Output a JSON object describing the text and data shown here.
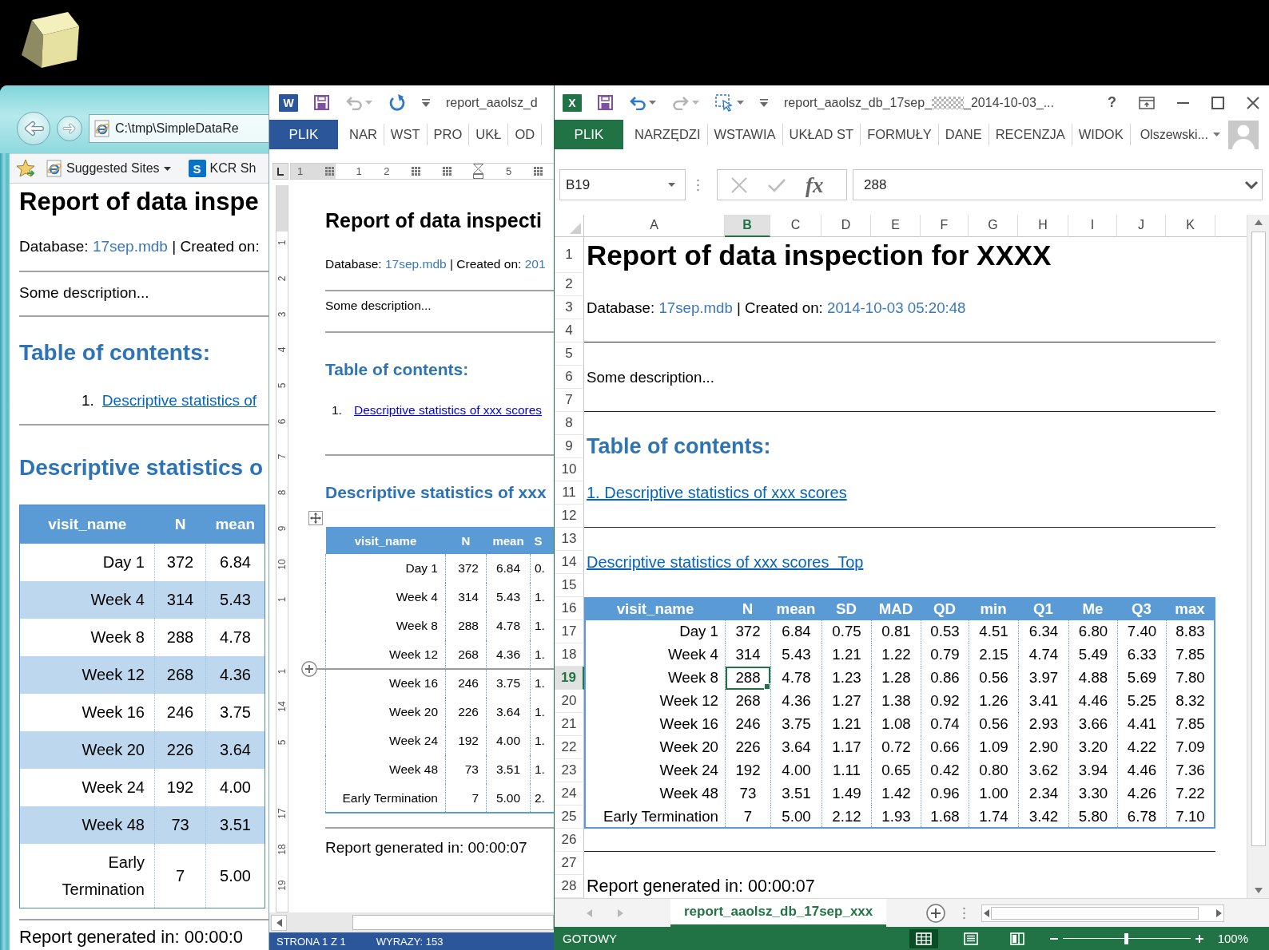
{
  "browser": {
    "address": "C:\\tmp\\SimpleDataRe",
    "favorites": [
      {
        "kind": "dropdown",
        "label": "Suggested Sites"
      },
      {
        "kind": "site",
        "icon_letter": "S",
        "label": "KCR Sh"
      }
    ],
    "report": {
      "title": "Report of data inspe",
      "database_label": "Database:",
      "database": "17sep.mdb",
      "created_label": "| Created on:",
      "description": "Some description...",
      "toc_heading": "Table of contents:",
      "toc": [
        {
          "number": "1.",
          "label": "Descriptive statistics of"
        }
      ],
      "section_heading": "Descriptive statistics o",
      "table": {
        "columns": [
          "visit_name",
          "N",
          "mean"
        ],
        "rows": [
          [
            "Day 1",
            "372",
            "6.84"
          ],
          [
            "Week 4",
            "314",
            "5.43"
          ],
          [
            "Week 8",
            "288",
            "4.78"
          ],
          [
            "Week 12",
            "268",
            "4.36"
          ],
          [
            "Week 16",
            "246",
            "3.75"
          ],
          [
            "Week 20",
            "226",
            "3.64"
          ],
          [
            "Week 24",
            "192",
            "4.00"
          ],
          [
            "Week 48",
            "73",
            "3.51"
          ],
          [
            "Early Termination",
            "7",
            "5.00"
          ]
        ]
      },
      "footer": "Report generated in: 00:00:0"
    }
  },
  "word": {
    "app_letter": "W",
    "title": "report_aaolsz_d",
    "tabs": [
      {
        "kind": "file",
        "label": "PLIK"
      },
      {
        "kind": "tab",
        "label": "NAR"
      },
      {
        "kind": "tab",
        "label": "WST"
      },
      {
        "kind": "tab",
        "label": "PRO"
      },
      {
        "kind": "tab",
        "label": "UKŁ"
      },
      {
        "kind": "tab",
        "label": "OD"
      }
    ],
    "ruler": [
      {
        "kind": "number",
        "label": "1"
      },
      {
        "kind": "marker"
      },
      {
        "kind": "number",
        "label": "1"
      },
      {
        "kind": "number",
        "label": "2"
      },
      {
        "kind": "marker"
      },
      {
        "kind": "marker"
      },
      {
        "kind": "indent"
      },
      {
        "kind": "number",
        "label": "5"
      },
      {
        "kind": "marker"
      }
    ],
    "vertical_ruler": [
      {
        "kind": "number",
        "label": "1"
      },
      {
        "kind": "number",
        "label": "2"
      },
      {
        "kind": "number",
        "label": "3"
      },
      {
        "kind": "number",
        "label": "4"
      },
      {
        "kind": "number",
        "label": "5"
      },
      {
        "kind": "number",
        "label": "6"
      },
      {
        "kind": "number",
        "label": "7"
      },
      {
        "kind": "number",
        "label": "8"
      },
      {
        "kind": "number",
        "label": "9"
      },
      {
        "kind": "number",
        "label": "10"
      },
      {
        "kind": "number",
        "label": "1"
      },
      {
        "kind": "ticks"
      },
      {
        "kind": "number",
        "label": "1"
      },
      {
        "kind": "number",
        "label": "14"
      },
      {
        "kind": "number",
        "label": "5"
      },
      {
        "kind": "ticks"
      },
      {
        "kind": "number",
        "label": "17"
      },
      {
        "kind": "number",
        "label": "18"
      },
      {
        "kind": "number",
        "label": "19"
      }
    ],
    "document": {
      "title": "Report of data inspecti",
      "database_label": "Database:",
      "database": "17sep.mdb",
      "created_label": "| Created on:",
      "created": "201",
      "description": "Some description...",
      "toc_heading": "Table of contents:",
      "toc": [
        {
          "number": "1.",
          "label": "Descriptive statistics of xxx scores"
        }
      ],
      "section_heading": "Descriptive statistics of xxx",
      "table": {
        "columns": [
          "visit_name",
          "N",
          "mean",
          "S"
        ],
        "rows": [
          [
            "Day 1",
            "372",
            "6.84",
            "0."
          ],
          [
            "Week 4",
            "314",
            "5.43",
            "1."
          ],
          [
            "Week 8",
            "288",
            "4.78",
            "1."
          ],
          [
            "Week 12",
            "268",
            "4.36",
            "1."
          ],
          [
            "Week 16",
            "246",
            "3.75",
            "1."
          ],
          [
            "Week 20",
            "226",
            "3.64",
            "1."
          ],
          [
            "Week 24",
            "192",
            "4.00",
            "1."
          ],
          [
            "Week 48",
            "73",
            "3.51",
            "1."
          ],
          [
            "Early Termination",
            "7",
            "5.00",
            "2."
          ]
        ]
      },
      "footer": "Report generated in: 00:00:07"
    },
    "status": [
      "STRONA 1 Z 1",
      "WYRAZY: 153"
    ]
  },
  "excel": {
    "app_letter": "X",
    "title_start": "report_aaolsz_db_17sep_",
    "title_end": "_2014-10-03_...",
    "help": "?",
    "tabs": [
      {
        "kind": "file",
        "label": "PLIK"
      },
      {
        "kind": "tab",
        "label": "NARZĘDZI"
      },
      {
        "kind": "tab",
        "label": "WSTAWIA"
      },
      {
        "kind": "tab",
        "label": "UKŁAD ST"
      },
      {
        "kind": "tab",
        "label": "FORMUŁY"
      },
      {
        "kind": "tab",
        "label": "DANE"
      },
      {
        "kind": "tab",
        "label": "RECENZJA"
      },
      {
        "kind": "tab",
        "label": "WIDOK"
      }
    ],
    "account": "Olszewski...",
    "name_box": "B19",
    "function_label": "fx",
    "formula": "288",
    "columns": [
      {
        "label": "A",
        "selected": false
      },
      {
        "label": "B",
        "selected": true
      },
      {
        "label": "C",
        "selected": false
      },
      {
        "label": "D",
        "selected": false
      },
      {
        "label": "E",
        "selected": false
      },
      {
        "label": "F",
        "selected": false
      },
      {
        "label": "G",
        "selected": false
      },
      {
        "label": "H",
        "selected": false
      },
      {
        "label": "I",
        "selected": false
      },
      {
        "label": "J",
        "selected": false
      },
      {
        "label": "K",
        "selected": false
      }
    ],
    "rows": [
      {
        "number": "1",
        "selected": false,
        "kind": "title",
        "text": "Report of data inspection for XXXX"
      },
      {
        "number": "2",
        "selected": false,
        "kind": "blank"
      },
      {
        "number": "3",
        "selected": false,
        "kind": "meta",
        "database_label": "Database:",
        "database": "17sep.mdb",
        "created_label": "| Created on:",
        "created": "2014-10-03 05:20:48"
      },
      {
        "number": "4",
        "selected": false,
        "kind": "rule"
      },
      {
        "number": "5",
        "selected": false,
        "kind": "blank"
      },
      {
        "number": "6",
        "selected": false,
        "kind": "text",
        "text": "Some description..."
      },
      {
        "number": "7",
        "selected": false,
        "kind": "rule"
      },
      {
        "number": "8",
        "selected": false,
        "kind": "blank"
      },
      {
        "number": "9",
        "selected": false,
        "kind": "heading",
        "text": "Table of contents:"
      },
      {
        "number": "10",
        "selected": false,
        "kind": "blank"
      },
      {
        "number": "11",
        "selected": false,
        "kind": "link",
        "text": "1. Descriptive statistics of xxx scores"
      },
      {
        "number": "12",
        "selected": false,
        "kind": "rule"
      },
      {
        "number": "13",
        "selected": false,
        "kind": "blank"
      },
      {
        "number": "14",
        "selected": false,
        "kind": "link",
        "text": "Descriptive statistics of xxx scores  Top"
      },
      {
        "number": "15",
        "selected": false,
        "kind": "blank"
      },
      {
        "number": "16",
        "selected": false,
        "kind": "table_header",
        "cells": [
          "visit_name",
          "N",
          "mean",
          "SD",
          "MAD",
          "QD",
          "min",
          "Q1",
          "Me",
          "Q3",
          "max"
        ]
      },
      {
        "number": "17",
        "selected": false,
        "kind": "table_row",
        "cells": [
          "Day 1",
          "372",
          "6.84",
          "0.75",
          "0.81",
          "0.53",
          "4.51",
          "6.34",
          "6.80",
          "7.40",
          "8.83"
        ]
      },
      {
        "number": "18",
        "selected": false,
        "kind": "table_row",
        "cells": [
          "Week 4",
          "314",
          "5.43",
          "1.21",
          "1.22",
          "0.79",
          "2.15",
          "4.74",
          "5.49",
          "6.33",
          "7.85"
        ]
      },
      {
        "number": "19",
        "selected": true,
        "kind": "table_row",
        "cells": [
          "Week 8",
          "288",
          "4.78",
          "1.23",
          "1.28",
          "0.86",
          "0.56",
          "3.97",
          "4.88",
          "5.69",
          "7.80"
        ]
      },
      {
        "number": "20",
        "selected": false,
        "kind": "table_row",
        "cells": [
          "Week 12",
          "268",
          "4.36",
          "1.27",
          "1.38",
          "0.92",
          "1.26",
          "3.41",
          "4.46",
          "5.25",
          "8.32"
        ]
      },
      {
        "number": "21",
        "selected": false,
        "kind": "table_row",
        "cells": [
          "Week 16",
          "246",
          "3.75",
          "1.21",
          "1.08",
          "0.74",
          "0.56",
          "2.93",
          "3.66",
          "4.41",
          "7.85"
        ]
      },
      {
        "number": "22",
        "selected": false,
        "kind": "table_row",
        "cells": [
          "Week 20",
          "226",
          "3.64",
          "1.17",
          "0.72",
          "0.66",
          "1.09",
          "2.90",
          "3.20",
          "4.22",
          "7.09"
        ]
      },
      {
        "number": "23",
        "selected": false,
        "kind": "table_row",
        "cells": [
          "Week 24",
          "192",
          "4.00",
          "1.11",
          "0.65",
          "0.42",
          "0.80",
          "3.62",
          "3.94",
          "4.46",
          "7.36"
        ]
      },
      {
        "number": "24",
        "selected": false,
        "kind": "table_row",
        "cells": [
          "Week 48",
          "73",
          "3.51",
          "1.49",
          "1.42",
          "0.96",
          "1.00",
          "2.34",
          "3.30",
          "4.26",
          "7.22"
        ]
      },
      {
        "number": "25",
        "selected": false,
        "kind": "table_row",
        "cells": [
          "Early Termination",
          "7",
          "5.00",
          "2.12",
          "1.93",
          "1.68",
          "1.74",
          "3.42",
          "5.80",
          "6.78",
          "7.10"
        ]
      },
      {
        "number": "26",
        "selected": false,
        "kind": "rule"
      },
      {
        "number": "27",
        "selected": false,
        "kind": "blank"
      },
      {
        "number": "28",
        "selected": false,
        "kind": "footer",
        "text": "Report generated in: 00:00:07"
      }
    ],
    "sheet_tabs": [
      {
        "label": "report_aaolsz_db_17sep_xxx",
        "selected": true
      }
    ],
    "status": "GOTOWY",
    "views": [
      {
        "kind": "normal",
        "selected": true
      },
      {
        "kind": "page_layout",
        "selected": false
      },
      {
        "kind": "page_break",
        "selected": false
      }
    ],
    "zoom": {
      "level": 0.5,
      "reading": "100%"
    }
  }
}
